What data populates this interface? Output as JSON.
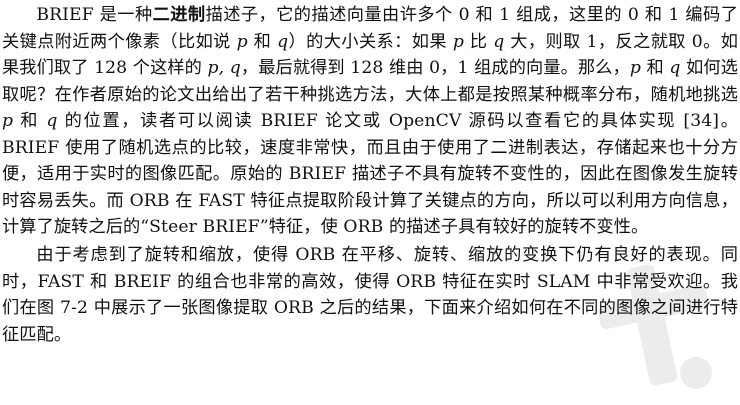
{
  "paragraphs": [
    {
      "segments": [
        {
          "type": "text",
          "text": "BRIEF 是一种"
        },
        {
          "type": "bold",
          "text": "二进制"
        },
        {
          "type": "text",
          "text": "描述子，它的描述向量由许多个 0 和 1 组成，这里的 0 和 1 编码了关键点附近两个像素（比如说 "
        },
        {
          "type": "math",
          "text": "p"
        },
        {
          "type": "text",
          "text": " 和 "
        },
        {
          "type": "math",
          "text": "q"
        },
        {
          "type": "text",
          "text": "）的大小关系：如果 "
        },
        {
          "type": "math",
          "text": "p"
        },
        {
          "type": "text",
          "text": " 比 "
        },
        {
          "type": "math",
          "text": "q"
        },
        {
          "type": "text",
          "text": " 大，则取 1，反之就取 0。如果我们取了 128 个这样的 "
        },
        {
          "type": "math",
          "text": "p, q"
        },
        {
          "type": "text",
          "text": "，最后就得到 128 维由 0，1 组成的向量。那么，"
        },
        {
          "type": "math",
          "text": "p"
        },
        {
          "type": "text",
          "text": " 和 "
        },
        {
          "type": "math",
          "text": "q"
        },
        {
          "type": "text",
          "text": " 如何选取呢？在作者原始的论文出给出了若干种挑选方法，大体上都是按照某种概率分布，随机地挑选 "
        },
        {
          "type": "math",
          "text": "p"
        },
        {
          "type": "text",
          "text": " 和 "
        },
        {
          "type": "math",
          "text": "q"
        },
        {
          "type": "text",
          "text": " 的位置，读者可以阅读 BRIEF 论文或 OpenCV 源码以查看它的具体实现 [34]。BRIEF 使用了随机选点的比较，速度非常快，而且由于使用了二进制表达，存储起来也十分方便，适用于实时的图像匹配。原始的 BRIEF 描述子不具有旋转不变性的，因此在图像发生旋转时容易丢失。而 ORB 在 FAST 特征点提取阶段计算了关键点的方向，所以可以利用方向信息，计算了旋转之后的“Steer BRIEF”特征，使 ORB 的描述子具有较好的旋转不变性。"
        }
      ]
    },
    {
      "segments": [
        {
          "type": "text",
          "text": "由于考虑到了旋转和缩放，使得 ORB 在平移、旋转、缩放的变换下仍有良好的表现。同时，FAST 和 BREIF 的组合也非常的高效，使得 ORB 特征在实时 SLAM 中非常受欢迎。我们在图 7-2 中展示了一张图像提取 ORB 之后的结果，下面来介绍如何在不同的图像之间进行特征匹配。"
        }
      ]
    }
  ],
  "colors": {
    "text": "#111111",
    "background": "#ffffff",
    "watermark": "#ececec"
  }
}
